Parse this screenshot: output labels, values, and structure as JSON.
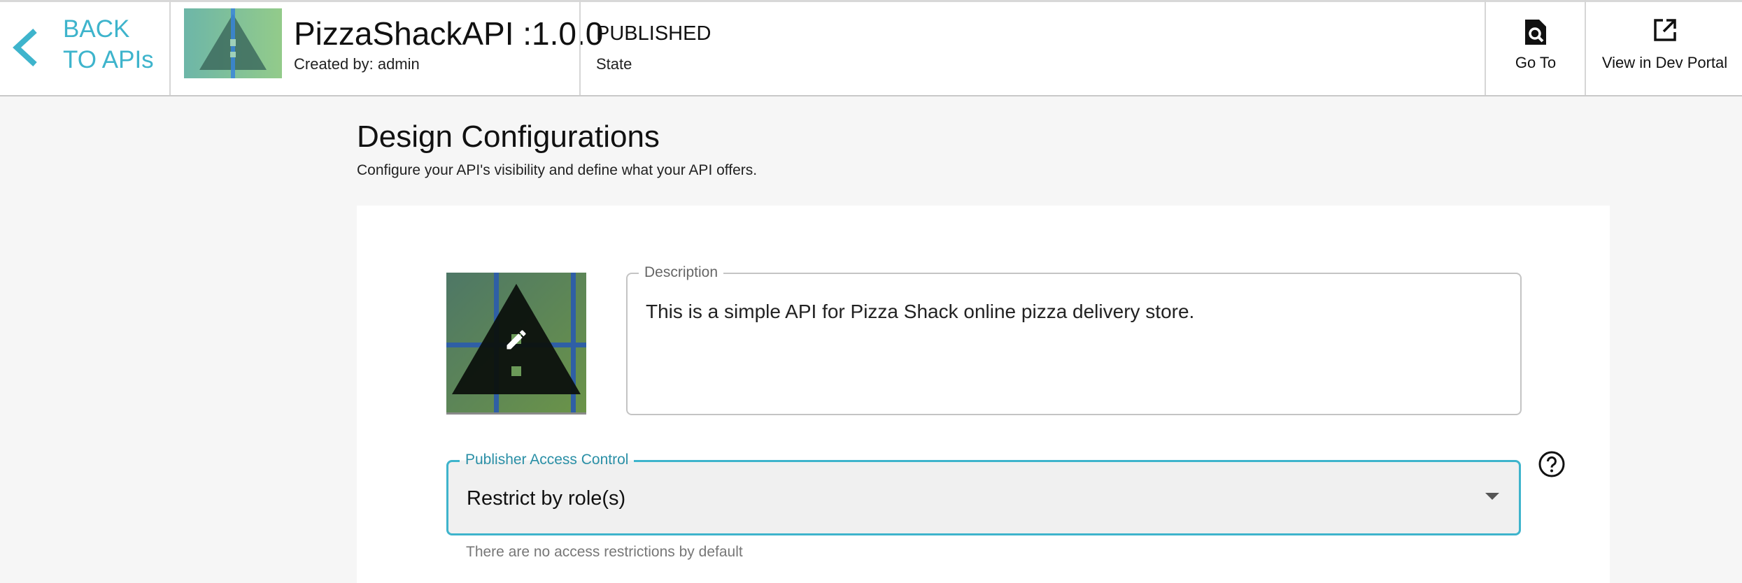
{
  "header": {
    "back_label": "BACK TO APIs",
    "api_name": "PizzaShackAPI :1.0.0",
    "created_by": "Created by: admin",
    "state_value": "PUBLISHED",
    "state_label": "State",
    "goto_label": "Go To",
    "devportal_label": "View in Dev Portal"
  },
  "page": {
    "title": "Design Configurations",
    "subtitle": "Configure your API's visibility and define what your API offers."
  },
  "form": {
    "description_label": "Description",
    "description_value": "This is a simple API for Pizza Shack online pizza delivery store.",
    "access_control_label": "Publisher Access Control",
    "access_control_value": "Restrict by role(s)",
    "access_control_helper": "There are no access restrictions by default"
  },
  "icons": {
    "back": "chevron-left-icon",
    "goto": "find-in-page-icon",
    "devportal": "open-in-new-icon",
    "edit": "pencil-icon",
    "help": "help-circle-icon",
    "dropdown": "caret-down-icon"
  },
  "colors": {
    "accent": "#3eb4cc",
    "accent_dark": "#2a8fa6"
  }
}
